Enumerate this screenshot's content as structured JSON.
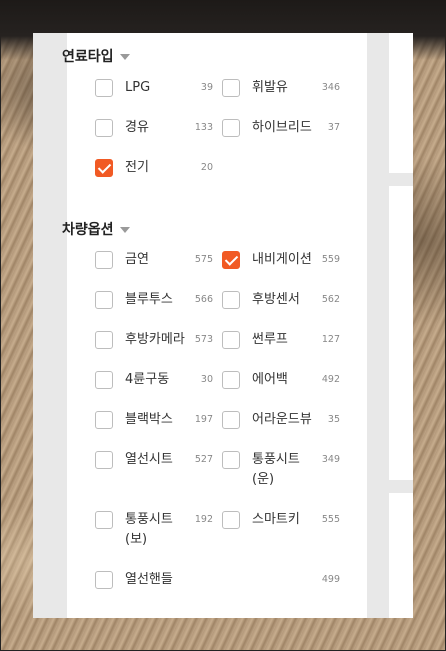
{
  "fuel_section": {
    "title": "연료타입",
    "options": [
      {
        "label": "LPG",
        "count": "39",
        "checked": false
      },
      {
        "label": "휘발유",
        "count": "346",
        "checked": false
      },
      {
        "label": "경유",
        "count": "133",
        "checked": false
      },
      {
        "label": "하이브리드",
        "count": "37",
        "checked": false
      },
      {
        "label": "전기",
        "count": "20",
        "checked": true
      }
    ]
  },
  "option_section": {
    "title": "차량옵션",
    "options": [
      {
        "label": "금연",
        "count": "575",
        "checked": false
      },
      {
        "label": "내비게이션",
        "count": "559",
        "checked": true
      },
      {
        "label": "블루투스",
        "count": "566",
        "checked": false
      },
      {
        "label": "후방센서",
        "count": "562",
        "checked": false
      },
      {
        "label": "후방카메라",
        "count": "573",
        "checked": false
      },
      {
        "label": "썬루프",
        "count": "127",
        "checked": false
      },
      {
        "label": "4륜구동",
        "count": "30",
        "checked": false
      },
      {
        "label": "에어백",
        "count": "492",
        "checked": false
      },
      {
        "label": "블랙박스",
        "count": "197",
        "checked": false
      },
      {
        "label": "어라운드뷰",
        "count": "35",
        "checked": false
      },
      {
        "label": "열선시트",
        "count": "527",
        "checked": false
      },
      {
        "label": "통풍시트 (운)",
        "count": "349",
        "checked": false
      },
      {
        "label": "통풍시트 (보)",
        "count": "192",
        "checked": false
      },
      {
        "label": "스마트키",
        "count": "555",
        "checked": false
      },
      {
        "label": "열선핸들",
        "count": "499",
        "checked": false
      }
    ]
  },
  "colors": {
    "accent": "#f15a24",
    "panel_gray": "#e8e8e8"
  }
}
